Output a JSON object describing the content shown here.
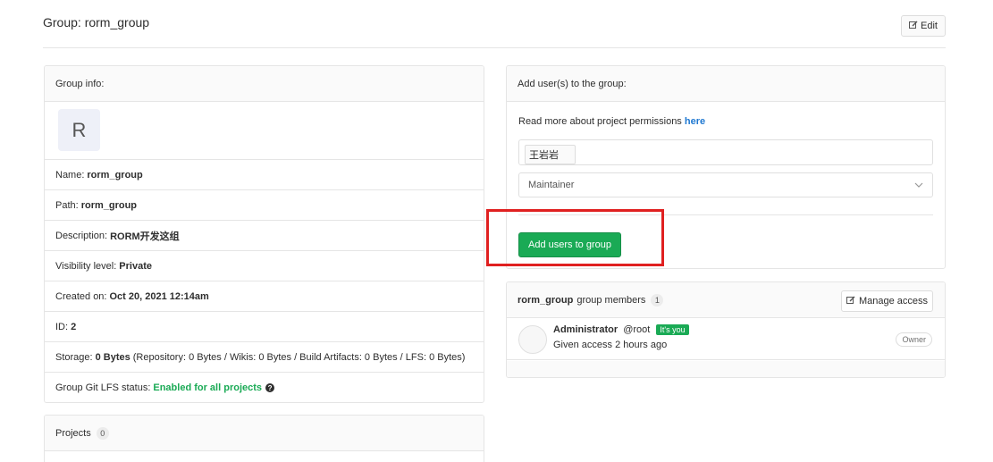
{
  "page": {
    "title": "Group: rorm_group",
    "edit_label": "Edit"
  },
  "info": {
    "header": "Group info:",
    "avatar_letter": "R",
    "rows": [
      {
        "label": "Name:",
        "value": "rorm_group"
      },
      {
        "label": "Path:",
        "value": "rorm_group"
      },
      {
        "label": "Description:",
        "value": "RORM开发这组"
      },
      {
        "label": "Visibility level:",
        "value": "Private"
      },
      {
        "label": "Created on:",
        "value": "Oct 20, 2021 12:14am"
      },
      {
        "label": "ID:",
        "value": "2"
      }
    ],
    "storage": {
      "label": "Storage:",
      "value": "0 Bytes",
      "detail": "(Repository: 0 Bytes / Wikis: 0 Bytes / Build Artifacts: 0 Bytes / LFS: 0 Bytes)"
    },
    "lfs": {
      "label": "Group Git LFS status:",
      "value": "Enabled for all projects"
    }
  },
  "projects": {
    "header": "Projects",
    "count": "0"
  },
  "add_users": {
    "header": "Add user(s) to the group:",
    "read_more_text": "Read more about project permissions",
    "read_more_link": "here",
    "selected_user": "王岩岩",
    "role": "Maintainer",
    "submit_label": "Add users to group"
  },
  "members": {
    "group_name": "rorm_group",
    "header_suffix": "group members",
    "count": "1",
    "manage_label": "Manage access",
    "list": [
      {
        "name": "Administrator",
        "handle": "@root",
        "badge": "It's you",
        "access": "Given access 2 hours ago",
        "role": "Owner"
      }
    ]
  },
  "colors": {
    "success": "#1aaa55",
    "link": "#1f78d1",
    "highlight": "#e02020"
  }
}
